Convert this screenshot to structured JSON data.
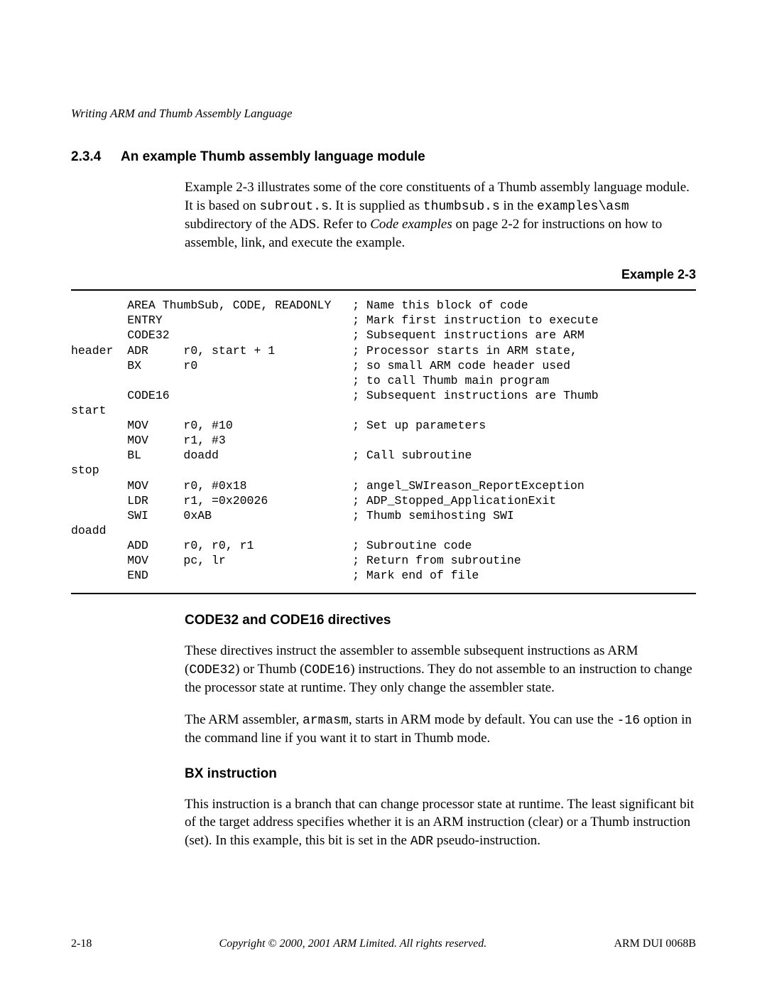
{
  "running_head": "Writing ARM and Thumb Assembly Language",
  "section": {
    "number": "2.3.4",
    "title": "An example Thumb assembly language module"
  },
  "intro": {
    "sentence1a": "Example 2-3 illustrates some of the core constituents of a Thumb assembly language module. It is based on ",
    "code1": "subrout.s",
    "sentence1b": ". It is supplied as ",
    "code2": "thumbsub.s",
    "sentence1c": " in the ",
    "code3": "examples\\asm",
    "sentence1d": " subdirectory of the ADS. Refer to ",
    "ital": "Code examples",
    "sentence1e": " on page 2-2 for instructions on how to assemble, link, and execute the example."
  },
  "example_label": "Example 2-3",
  "code_listing": "        AREA ThumbSub, CODE, READONLY   ; Name this block of code\n        ENTRY                           ; Mark first instruction to execute\n        CODE32                          ; Subsequent instructions are ARM\nheader  ADR     r0, start + 1           ; Processor starts in ARM state,\n        BX      r0                      ; so small ARM code header used\n                                        ; to call Thumb main program\n        CODE16                          ; Subsequent instructions are Thumb\nstart\n        MOV     r0, #10                 ; Set up parameters\n        MOV     r1, #3\n        BL      doadd                   ; Call subroutine\nstop\n        MOV     r0, #0x18               ; angel_SWIreason_ReportException\n        LDR     r1, =0x20026            ; ADP_Stopped_ApplicationExit\n        SWI     0xAB                    ; Thumb semihosting SWI\ndoadd\n        ADD     r0, r0, r1              ; Subroutine code\n        MOV     pc, lr                  ; Return from subroutine\n        END                             ; Mark end of file",
  "sub1": {
    "heading": "CODE32 and CODE16 directives",
    "p1a": "These directives instruct the assembler to assemble subsequent instructions as ARM (",
    "p1code1": "CODE32",
    "p1b": ") or Thumb (",
    "p1code2": "CODE16",
    "p1c": ") instructions. They do not assemble to an instruction to change the processor state at runtime. They only change the assembler state.",
    "p2a": "The ARM assembler, ",
    "p2code1": "armasm",
    "p2b": ", starts in ARM mode by default. You can use the ",
    "p2code2": "-16",
    "p2c": " option in the command line if you want it to start in Thumb mode."
  },
  "sub2": {
    "heading": "BX instruction",
    "p1a": "This instruction is a branch that can change processor state at runtime. The least significant bit of the target address specifies whether it is an ARM instruction (clear) or a Thumb instruction (set). In this example, this bit is set in the ",
    "p1code1": "ADR",
    "p1b": " pseudo-instruction."
  },
  "footer": {
    "left": "2-18",
    "center": "Copyright © 2000, 2001 ARM Limited. All rights reserved.",
    "right": "ARM DUI 0068B"
  }
}
